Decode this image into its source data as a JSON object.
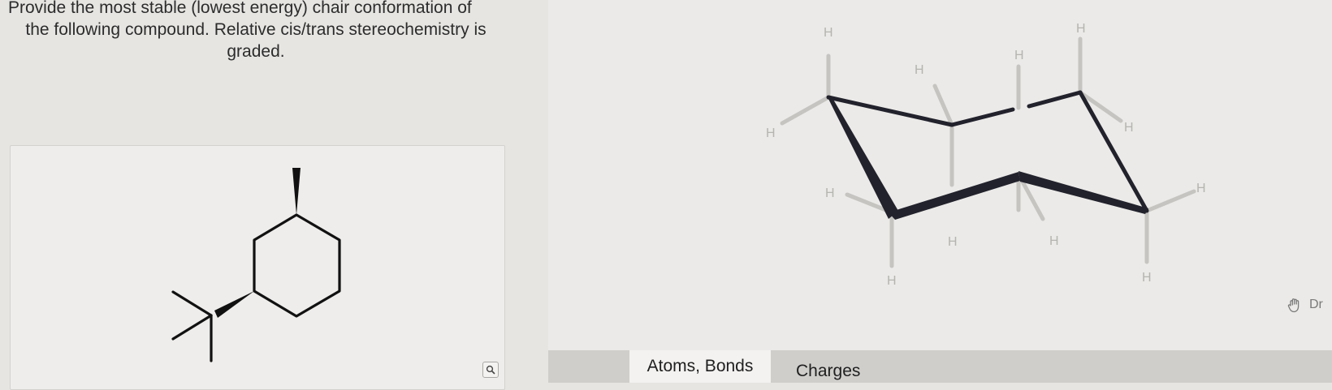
{
  "question": {
    "line1": "Provide the most stable (lowest energy) chair conformation of",
    "line2": "the following compound. Relative cis/trans stereochemistry is",
    "line3": "graded."
  },
  "chair_canvas": {
    "h_label": "H",
    "h_atom_count": 12
  },
  "tools": {
    "draw_label": "Dr",
    "draw_icon": "hand-icon",
    "zoom_icon": "magnifier-icon"
  },
  "tabs": [
    {
      "label": "Atoms, Bonds",
      "selected": true
    },
    {
      "label": "Charges",
      "selected": false
    }
  ]
}
